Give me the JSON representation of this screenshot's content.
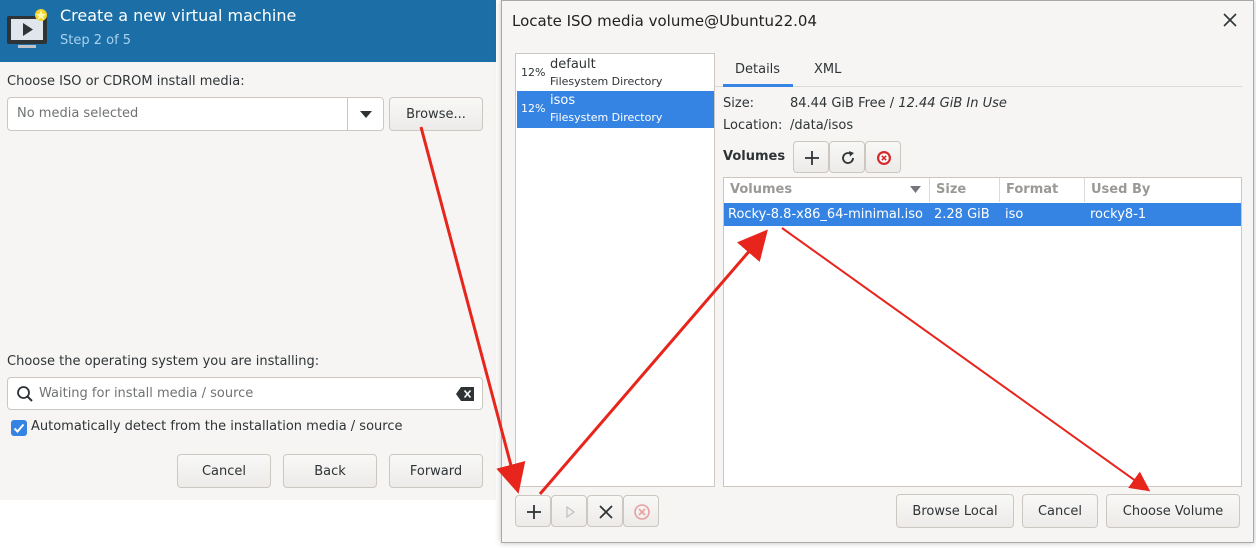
{
  "wizard": {
    "title": "Create a new virtual machine",
    "step": "Step 2 of 5",
    "iso_label": "Choose ISO or CDROM install media:",
    "iso_combo_value": "No media selected",
    "browse_label": "Browse...",
    "os_label": "Choose the operating system you are installing:",
    "os_search_placeholder": "Waiting for install media / source",
    "auto_detect_label": "Automatically detect from the installation media / source",
    "auto_detect_checked": true,
    "cancel_label": "Cancel",
    "back_label": "Back",
    "forward_label": "Forward"
  },
  "dialog": {
    "title": "Locate ISO media volume@Ubuntu22.04",
    "pools": [
      {
        "percent": "12%",
        "name": "default",
        "type": "Filesystem Directory",
        "selected": false
      },
      {
        "percent": "12%",
        "name": "isos",
        "type": "Filesystem Directory",
        "selected": true
      }
    ],
    "tabs": [
      {
        "label": "Details",
        "active": true
      },
      {
        "label": "XML",
        "active": false
      }
    ],
    "size_label": "Size:",
    "size_free": "84.44 GiB Free / ",
    "size_in_use": "12.44 GiB In Use",
    "location_label": "Location:",
    "location_value": "/data/isos",
    "volumes_label": "Volumes",
    "columns": [
      "Volumes",
      "Size",
      "Format",
      "Used By"
    ],
    "volumes": [
      {
        "name": "Rocky-8.8-x86_64-minimal.iso",
        "size": "2.28 GiB",
        "format": "iso",
        "used_by": "rocky8-1"
      }
    ],
    "browse_local_label": "Browse Local",
    "cancel_label": "Cancel",
    "choose_volume_label": "Choose Volume"
  },
  "colors": {
    "header_blue": "#1b6fa6",
    "selection_blue": "#3584e4",
    "annotation_red": "#e8251c",
    "delete_red": "#d42c2c"
  }
}
